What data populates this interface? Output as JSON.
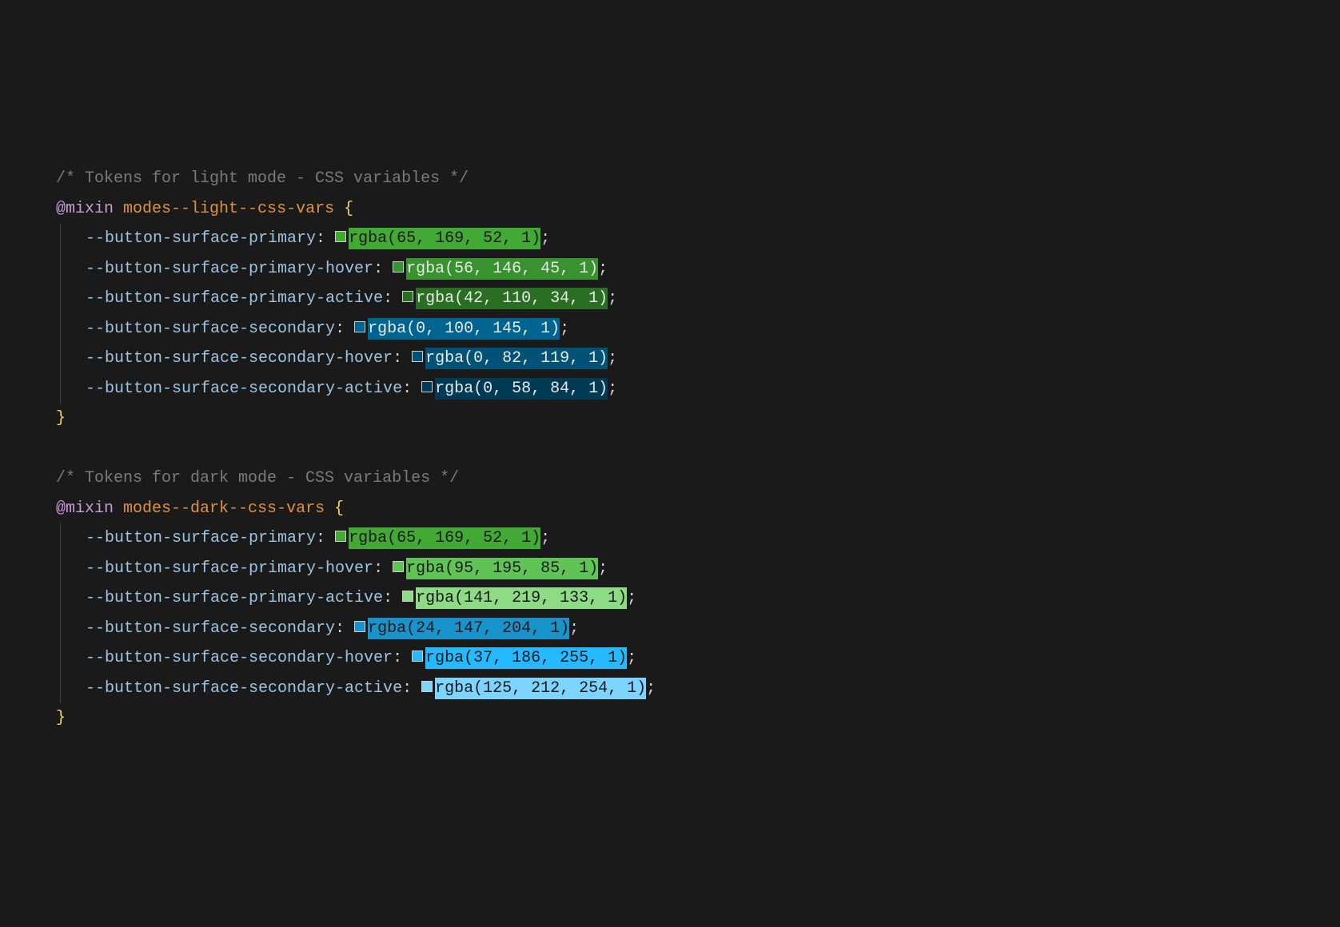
{
  "blocks": [
    {
      "comment": "/* Tokens for light mode - CSS variables */",
      "at_rule": "@mixin",
      "selector": "modes--light--css-vars",
      "open_brace": "{",
      "close_brace": "}",
      "props": [
        {
          "name": "--button-surface-primary",
          "value": "rgba(65, 169, 52, 1)",
          "swatch": "rgba(65,169,52,1)",
          "bg": "rgba(65,169,52,1)",
          "fg": "#1a1a1a"
        },
        {
          "name": "--button-surface-primary-hover",
          "value": "rgba(56, 146, 45, 1)",
          "swatch": "rgba(56,146,45,1)",
          "bg": "rgba(56,146,45,1)",
          "fg": "#e8e8e8"
        },
        {
          "name": "--button-surface-primary-active",
          "value": "rgba(42, 110, 34, 1)",
          "swatch": "rgba(42,110,34,1)",
          "bg": "rgba(42,110,34,1)",
          "fg": "#e8e8e8"
        },
        {
          "name": "--button-surface-secondary",
          "value": "rgba(0, 100, 145, 1)",
          "swatch": "rgba(0,100,145,1)",
          "bg": "rgba(0,100,145,1)",
          "fg": "#e8e8e8"
        },
        {
          "name": "--button-surface-secondary-hover",
          "value": "rgba(0, 82, 119, 1)",
          "swatch": "rgba(0,82,119,1)",
          "bg": "rgba(0,82,119,1)",
          "fg": "#e8e8e8"
        },
        {
          "name": "--button-surface-secondary-active",
          "value": "rgba(0, 58, 84, 1)",
          "swatch": "rgba(0,58,84,1)",
          "bg": "rgba(0,58,84,1)",
          "fg": "#e8e8e8"
        }
      ]
    },
    {
      "comment": "/* Tokens for dark mode - CSS variables */",
      "at_rule": "@mixin",
      "selector": "modes--dark--css-vars",
      "open_brace": "{",
      "close_brace": "}",
      "props": [
        {
          "name": "--button-surface-primary",
          "value": "rgba(65, 169, 52, 1)",
          "swatch": "rgba(65,169,52,1)",
          "bg": "rgba(65,169,52,1)",
          "fg": "#1a1a1a"
        },
        {
          "name": "--button-surface-primary-hover",
          "value": "rgba(95, 195, 85, 1)",
          "swatch": "rgba(95,195,85,1)",
          "bg": "rgba(95,195,85,1)",
          "fg": "#1a1a1a"
        },
        {
          "name": "--button-surface-primary-active",
          "value": "rgba(141, 219, 133, 1)",
          "swatch": "rgba(141,219,133,1)",
          "bg": "rgba(141,219,133,1)",
          "fg": "#1a1a1a"
        },
        {
          "name": "--button-surface-secondary",
          "value": "rgba(24, 147, 204, 1)",
          "swatch": "rgba(24,147,204,1)",
          "bg": "rgba(24,147,204,1)",
          "fg": "#1a1a1a"
        },
        {
          "name": "--button-surface-secondary-hover",
          "value": "rgba(37, 186, 255, 1)",
          "swatch": "rgba(37,186,255,1)",
          "bg": "rgba(37,186,255,1)",
          "fg": "#1a1a1a"
        },
        {
          "name": "--button-surface-secondary-active",
          "value": "rgba(125, 212, 254, 1)",
          "swatch": "rgba(125,212,254,1)",
          "bg": "rgba(125,212,254,1)",
          "fg": "#1a1a1a"
        }
      ]
    }
  ]
}
